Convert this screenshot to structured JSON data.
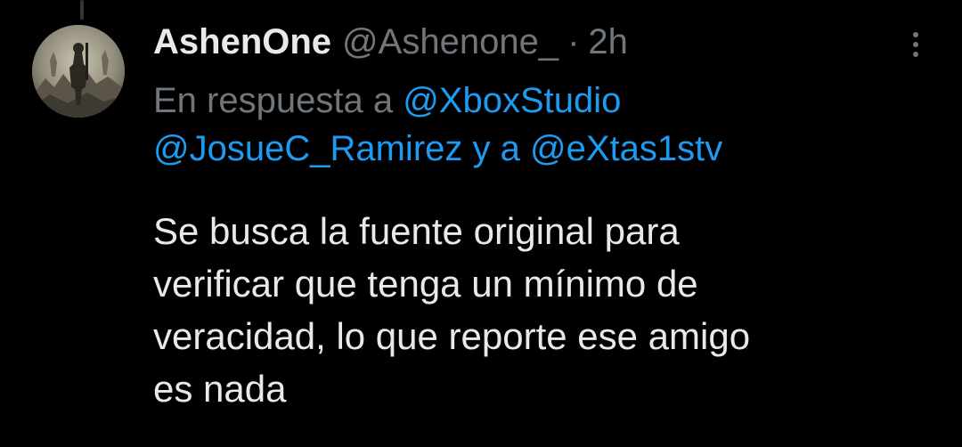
{
  "tweet": {
    "display_name": "AshenOne",
    "handle": "@Ashenone_",
    "separator": "·",
    "time": "2h",
    "reply_prefix": "En respuesta a",
    "mention_1": "@XboxStudio",
    "mention_2": "@JosueC_Ramirez",
    "reply_conjunction": "y a",
    "mention_3": "@eXtas1stv",
    "text_lines": [
      "Se busca la fuente original para",
      "verificar que tenga un mínimo de",
      "veracidad, lo que reporte ese amigo",
      "es nada"
    ]
  },
  "icons": {
    "more": "more-horizontal-icon",
    "avatar": "user-avatar"
  },
  "colors": {
    "background": "#000000",
    "primary_text": "#e7e9ea",
    "secondary_text": "#71767b",
    "link": "#1d9bf0"
  }
}
